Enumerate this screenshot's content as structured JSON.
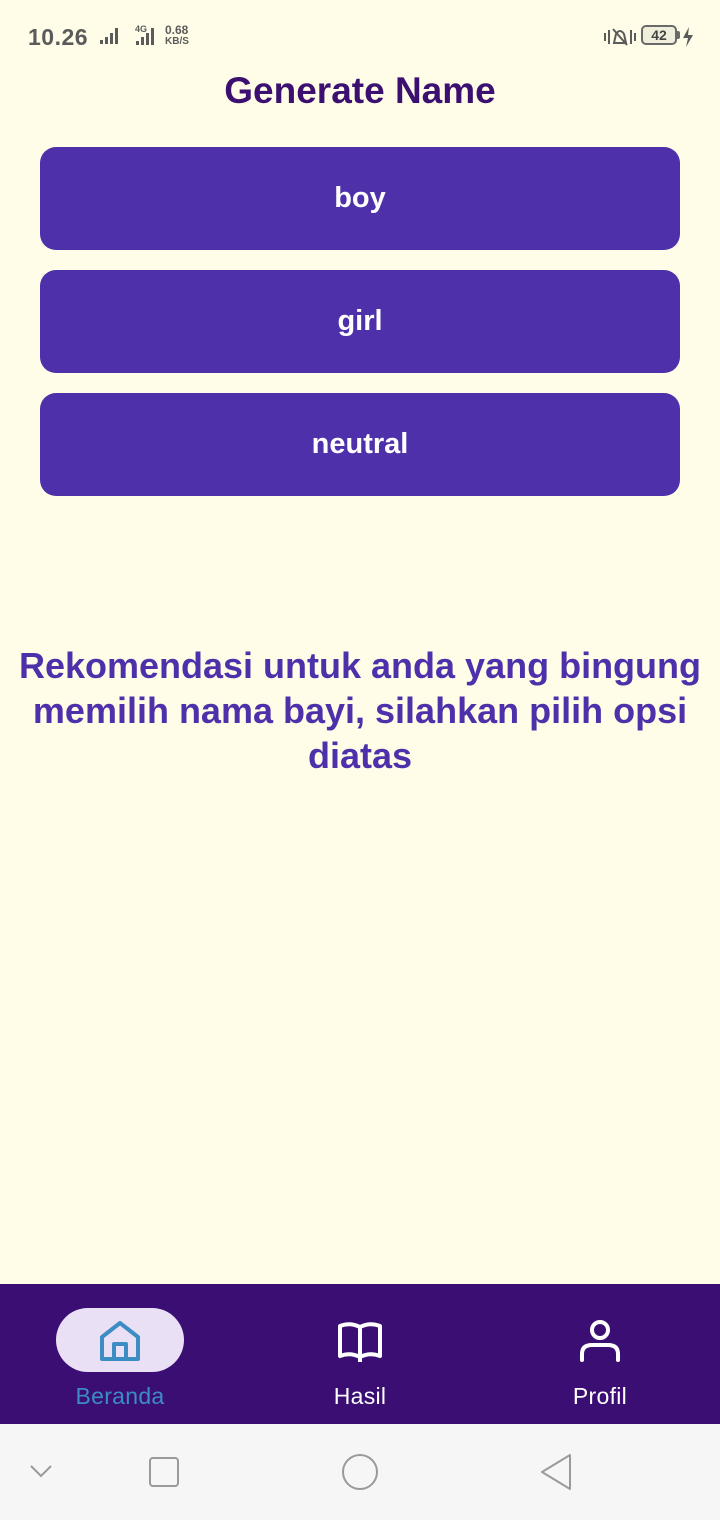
{
  "status_bar": {
    "time": "10.26",
    "network_type": "4G",
    "speed_value": "0.68",
    "speed_unit": "KB/S",
    "battery_level": "42"
  },
  "page": {
    "title": "Generate Name"
  },
  "options": {
    "boy": "boy",
    "girl": "girl",
    "neutral": "neutral"
  },
  "recommendation": {
    "line1": "Rekomendasi untuk anda yang bingung",
    "line2": "memilih nama bayi, silahkan pilih opsi",
    "line3": "diatas"
  },
  "bottom_nav": {
    "active_item": "Beranda",
    "items": [
      {
        "label": "Beranda",
        "icon": "home-icon"
      },
      {
        "label": "Hasil",
        "icon": "book-icon"
      },
      {
        "label": "Profil",
        "icon": "person-icon"
      }
    ]
  },
  "system_nav": {
    "icons": [
      "chevron-down-icon",
      "recents-square-icon",
      "home-circle-icon",
      "back-triangle-icon"
    ]
  },
  "colors": {
    "background": "#FFFDE7",
    "title": "#3B1070",
    "button": "#4E31AA",
    "nav_bar": "#3A0E72",
    "nav_active_pill": "#E9E0F5",
    "nav_active_label": "#3C8DC3"
  }
}
